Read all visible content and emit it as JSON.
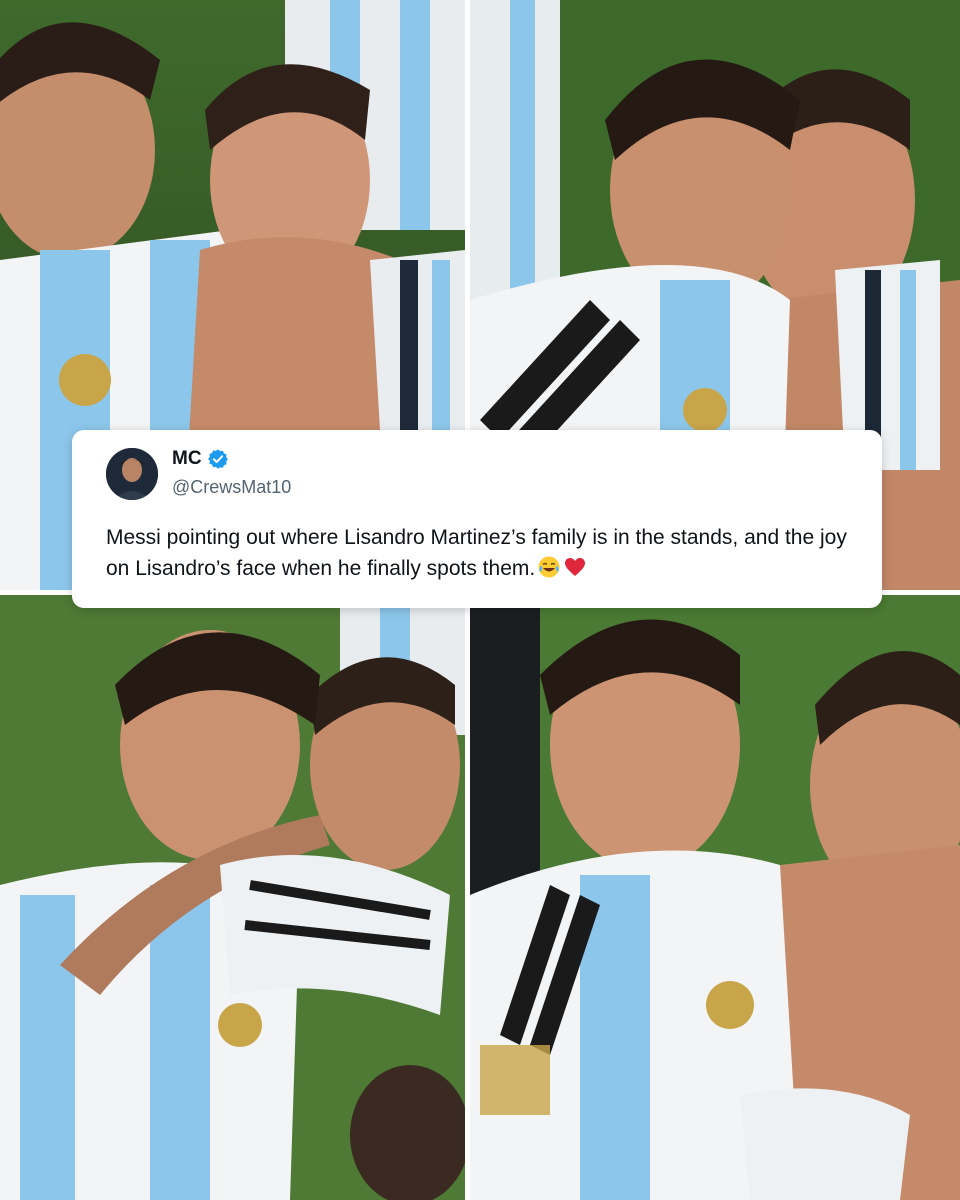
{
  "tweet": {
    "display_name": "MC",
    "handle": "@CrewsMat10",
    "text": "Messi pointing out where Lisandro Martinez’s family is in the stands, and the joy on Lisandro’s face when he finally spots them.",
    "emojis": [
      "face-with-tears-of-joy",
      "red-heart"
    ],
    "verified": true,
    "verified_color": "#1d9bf0"
  },
  "photos": [
    {
      "description_icon": "photo-top-left"
    },
    {
      "description_icon": "photo-top-right"
    },
    {
      "description_icon": "photo-bottom-left"
    },
    {
      "description_icon": "photo-bottom-right"
    }
  ],
  "colors": {
    "jersey_blue": "#8cc6ea",
    "jersey_white": "#f2f4f6",
    "grass": "#4e7a35",
    "skin": "#c98f6f"
  }
}
